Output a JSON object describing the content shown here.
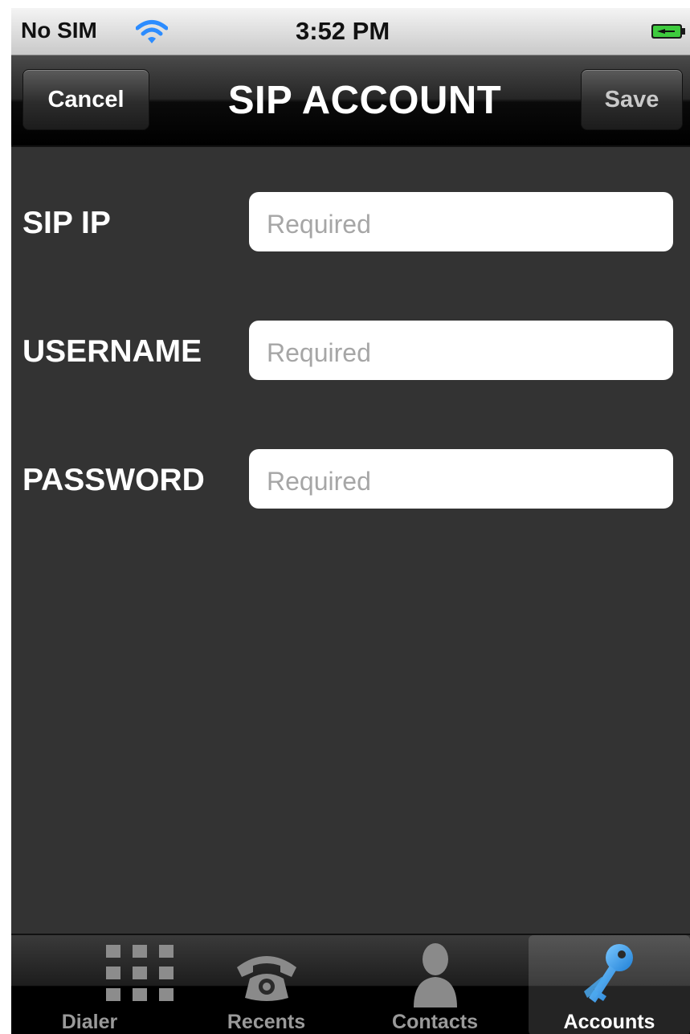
{
  "status_bar": {
    "carrier": "No SIM",
    "time": "3:52 PM",
    "wifi_icon": "wifi-icon",
    "battery_icon": "battery-charging-icon"
  },
  "nav": {
    "title": "SIP ACCOUNT",
    "cancel_label": "Cancel",
    "save_label": "Save"
  },
  "form": {
    "fields": [
      {
        "label": "SIP IP",
        "placeholder": "Required",
        "value": ""
      },
      {
        "label": "USERNAME",
        "placeholder": "Required",
        "value": ""
      },
      {
        "label": "PASSWORD",
        "placeholder": "Required",
        "value": ""
      }
    ]
  },
  "tab_bar": {
    "tabs": [
      {
        "label": "Dialer",
        "icon": "dialpad-icon",
        "selected": false
      },
      {
        "label": "Recents",
        "icon": "telephone-icon",
        "selected": false
      },
      {
        "label": "Contacts",
        "icon": "person-silhouette-icon",
        "selected": false
      },
      {
        "label": "Accounts",
        "icon": "keys-icon",
        "selected": true
      }
    ]
  },
  "colors": {
    "background": "#333333",
    "accent_blue": "#3aa0f0",
    "selected_tab_text": "#ffffff",
    "unselected_tab_text": "#9a9a9a"
  }
}
